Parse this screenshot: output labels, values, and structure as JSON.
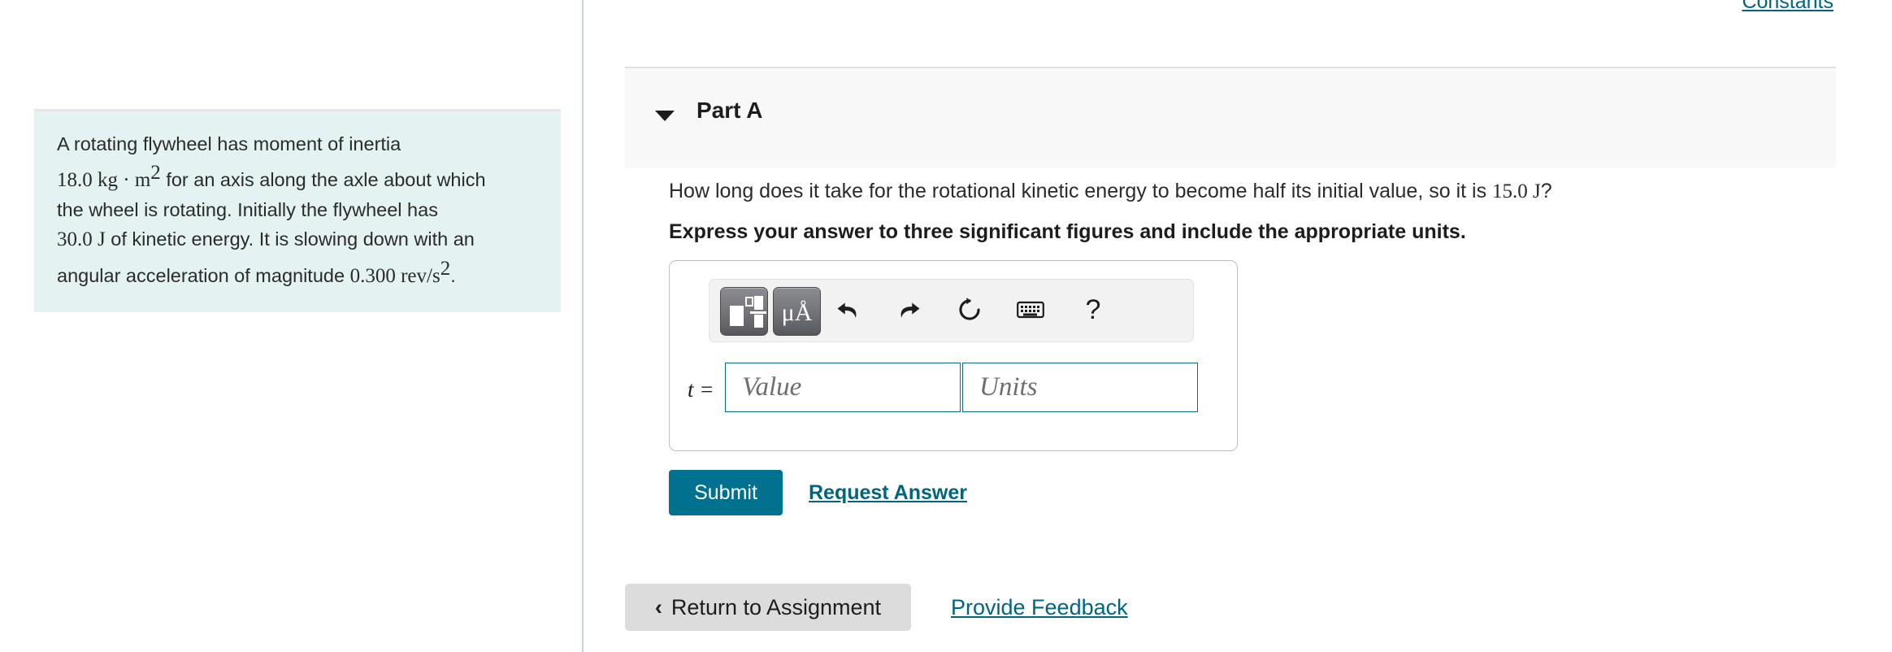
{
  "problem": {
    "line1": "A rotating flywheel has moment of inertia",
    "value_inertia": "18.0",
    "unit_inertia": "kg · m",
    "unit_inertia_sup": "2",
    "line2_tail": "for an axis along the axle about which",
    "line3": "the wheel is rotating. Initially the flywheel has",
    "value_energy": "30.0",
    "unit_energy": "J",
    "line4_tail": "of kinetic energy. It is slowing down with an",
    "line5_head": "angular acceleration of magnitude",
    "value_alpha": "0.300",
    "unit_alpha": "rev/s",
    "unit_alpha_sup": "2",
    "line5_tail": "."
  },
  "header": {
    "constants_label": "Constants"
  },
  "part": {
    "caret_icon": "chevron-down-icon",
    "label": "Part A",
    "question_head": "How long does it take for the rotational kinetic energy to become half its initial value, so it is",
    "question_value": "15.0",
    "question_unit": "J",
    "question_tail": "?",
    "instruction": "Express your answer to three significant figures and include the appropriate units."
  },
  "answer": {
    "toolbar": {
      "template_button_label": "math-template",
      "units_button_label": "μÅ",
      "undo_label": "undo",
      "redo_label": "redo",
      "reset_label": "reset",
      "keyboard_label": "keyboard",
      "help_label": "?"
    },
    "variable_label": "t =",
    "value_placeholder": "Value",
    "units_placeholder": "Units",
    "value_current": "",
    "units_current": ""
  },
  "actions": {
    "submit_label": "Submit",
    "request_answer_label": "Request Answer",
    "return_chevron": "‹",
    "return_label": "Return to Assignment",
    "feedback_label": "Provide Feedback"
  },
  "colors": {
    "accent_teal": "#00718e",
    "link_teal": "#00657f",
    "problem_bg": "#e4f3f1",
    "panel_bg": "#f8f8f8",
    "button_gray": "#dcdcdc",
    "field_border": "#0b6a85"
  }
}
